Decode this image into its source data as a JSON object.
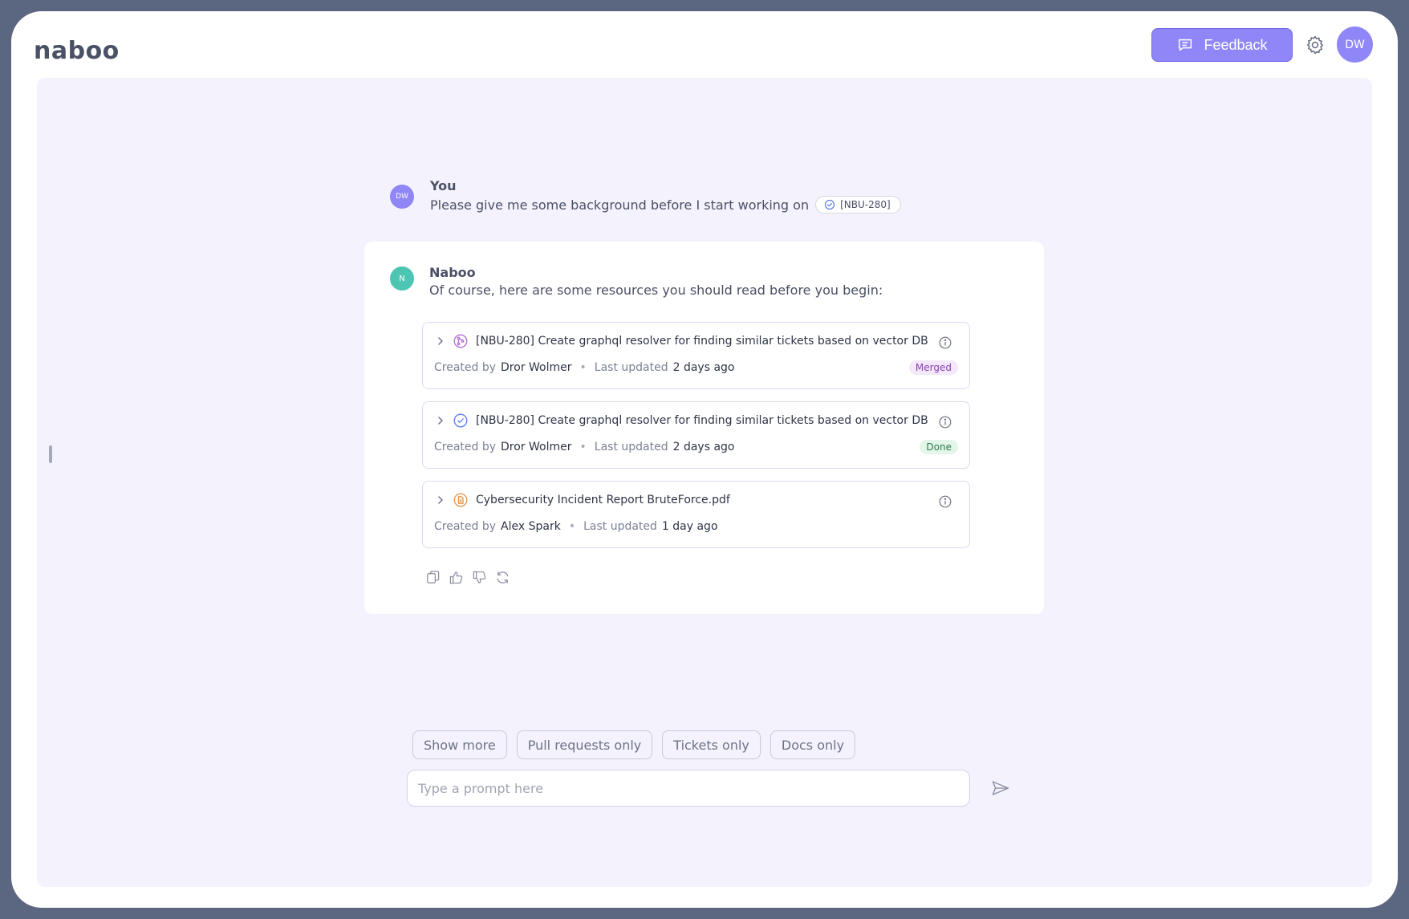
{
  "app": {
    "logo": "naboo",
    "feedback_label": "Feedback",
    "user_initials": "DW",
    "accent_color": "#8f87f7"
  },
  "chat": {
    "user_message": {
      "avatar": "DW",
      "author": "You",
      "text": "Please give me some background before I start working on",
      "ticket_ref": "[NBU-280]"
    },
    "bot_message": {
      "avatar": "N",
      "author": "Naboo",
      "text": "Of course, here are some resources you should read before you begin:",
      "resources": [
        {
          "icon": "pull-request-icon",
          "key": "[NBU-280]",
          "title": "Create graphql resolver for finding similar tickets based on vector DB",
          "created_by_label": "Created by",
          "author": "Dror Wolmer",
          "updated_label": "Last updated",
          "updated": "2 days ago",
          "status": "Merged"
        },
        {
          "icon": "ticket-icon",
          "key": "[NBU-280]",
          "title": "Create graphql resolver for finding similar tickets based on vector DB",
          "created_by_label": "Created by",
          "author": "Dror Wolmer",
          "updated_label": "Last updated",
          "updated": "2 days ago",
          "status": "Done"
        },
        {
          "icon": "document-icon",
          "key": "",
          "title": "Cybersecurity Incident Report BruteForce.pdf",
          "created_by_label": "Created by",
          "author": "Alex Spark",
          "updated_label": "Last updated",
          "updated": "1 day ago",
          "status": ""
        }
      ]
    }
  },
  "suggestions": [
    "Show more",
    "Pull requests only",
    "Tickets only",
    "Docs only"
  ],
  "prompt": {
    "placeholder": "Type a prompt here"
  }
}
